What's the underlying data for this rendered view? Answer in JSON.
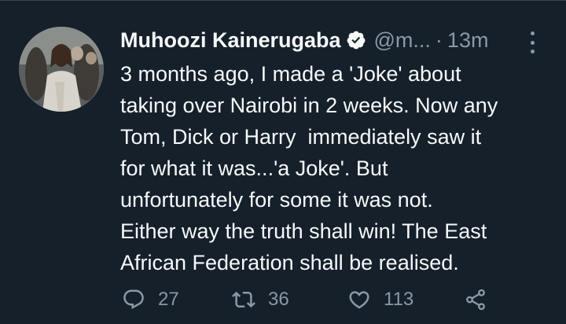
{
  "tweet": {
    "author_name": "Muhoozi Kainerugaba",
    "handle": "@m...",
    "separator": "·",
    "time": "13m",
    "text_lines": [
      "3 months ago, I made a 'Joke' about",
      "taking over Nairobi in 2 weeks. Now any",
      "Tom, Dick or Harry  immediately saw it",
      "for what it was...'a Joke'. But",
      "unfortunately for some it was not.",
      "Either way the truth shall win! The East",
      "African Federation shall be realised."
    ],
    "verified_icon": "verified-badge-icon",
    "more_icon": "more-options-icon"
  },
  "actions": {
    "reply": {
      "icon": "reply-icon",
      "count": "27"
    },
    "retweet": {
      "icon": "retweet-icon",
      "count": "36"
    },
    "like": {
      "icon": "heart-icon",
      "count": "113"
    },
    "share": {
      "icon": "share-icon"
    }
  },
  "colors": {
    "background": "#15202b",
    "text": "#f7f9f9",
    "secondary": "#8b98a5",
    "divider": "#38444d"
  }
}
